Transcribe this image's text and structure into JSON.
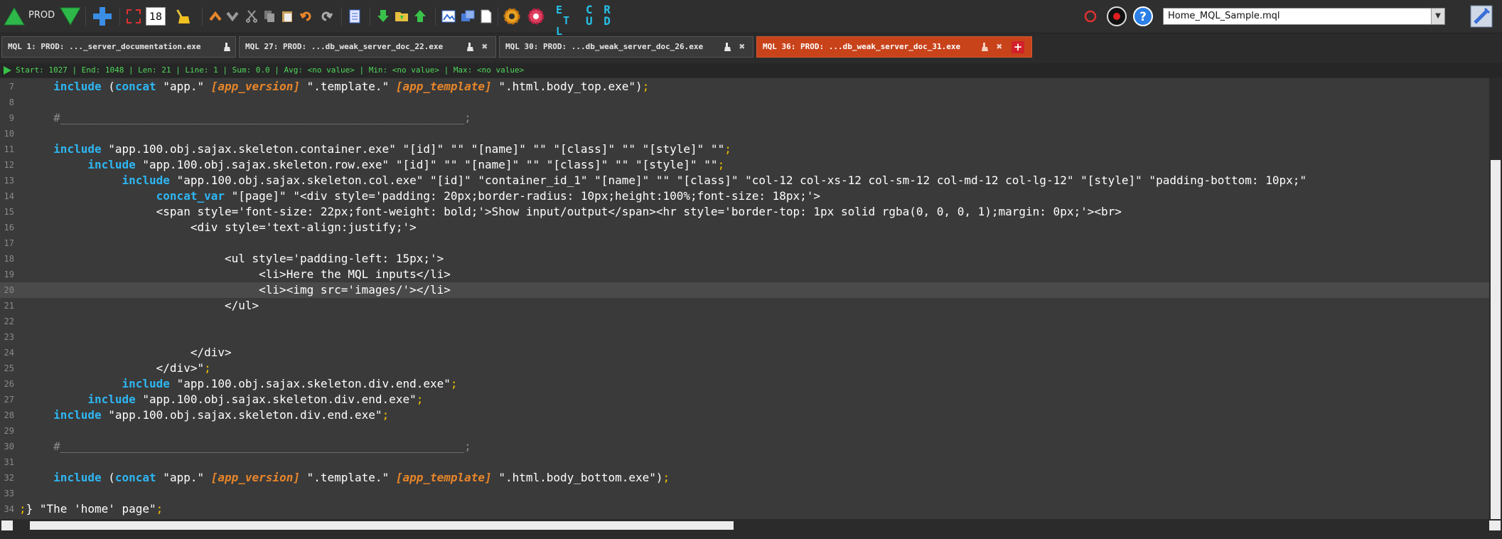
{
  "toolbar": {
    "prod_label": "PROD",
    "zoom_value": "18",
    "file_select": "Home_MQL_Sample.mql",
    "crud": [
      "C R",
      "U D"
    ],
    "etl": [
      "E",
      "T",
      "L"
    ]
  },
  "tabs": [
    {
      "label": "MQL 1: PROD: ..._server_documentation.exe",
      "active": false
    },
    {
      "label": "MQL 27: PROD: ...db_weak_server_doc_22.exe",
      "active": false
    },
    {
      "label": "MQL 30: PROD: ...db_weak_server_doc_26.exe",
      "active": false
    },
    {
      "label": "MQL 36: PROD: ...db_weak_server_doc_31.exe",
      "active": true
    }
  ],
  "status": {
    "text": "Start: 1027 | End: 1048 | Len: 21 | Line: 1 | Sum: 0.0 | Avg: <no value> | Min: <no value> | Max: <no value>"
  },
  "colors": {
    "keyword": "#2eb6f2",
    "variable": "#e8862a",
    "punctuation": "#f2c200",
    "active_tab": "#c8421a",
    "status": "#4fd85a"
  },
  "code": {
    "lines": [
      {
        "n": "7",
        "indent": "    ",
        "parts": [
          [
            "kw",
            "include"
          ],
          [
            "str",
            " ("
          ],
          [
            "fn",
            "concat"
          ],
          [
            "str",
            " \"app.\" "
          ],
          [
            "var",
            "[app_version]"
          ],
          [
            "str",
            " \".template.\" "
          ],
          [
            "var",
            "[app_template]"
          ],
          [
            "str",
            " \".html.body_top.exe\")"
          ],
          [
            "punc",
            ";"
          ]
        ]
      },
      {
        "n": "8",
        "indent": "",
        "parts": []
      },
      {
        "n": "9",
        "indent": "    ",
        "parts": [
          [
            "cmt",
            "#___________________________________________________________;"
          ]
        ]
      },
      {
        "n": "10",
        "indent": "",
        "parts": []
      },
      {
        "n": "11",
        "indent": "    ",
        "parts": [
          [
            "kw",
            "include"
          ],
          [
            "str",
            " \"app.100.obj.sajax.skeleton.container.exe\" \"[id]\" \"\" \"[name]\" \"\" \"[class]\" \"\" \"[style]\" \"\""
          ],
          [
            "punc",
            ";"
          ]
        ]
      },
      {
        "n": "12",
        "indent": "         ",
        "parts": [
          [
            "kw",
            "include"
          ],
          [
            "str",
            " \"app.100.obj.sajax.skeleton.row.exe\" \"[id]\" \"\" \"[name]\" \"\" \"[class]\" \"\" \"[style]\" \"\""
          ],
          [
            "punc",
            ";"
          ]
        ]
      },
      {
        "n": "13",
        "indent": "              ",
        "parts": [
          [
            "kw",
            "include"
          ],
          [
            "str",
            " \"app.100.obj.sajax.skeleton.col.exe\" \"[id]\" \"container_id_1\" \"[name]\" \"\" \"[class]\" \"col-12 col-xs-12 col-sm-12 col-md-12 col-lg-12\" \"[style]\" \"padding-bottom: 10px;\""
          ]
        ]
      },
      {
        "n": "14",
        "indent": "                   ",
        "parts": [
          [
            "kw",
            "concat_var"
          ],
          [
            "str",
            " \"[page]\" \"<div style='padding: 20px;border-radius: 10px;height:100%;font-size: 18px;'>"
          ]
        ]
      },
      {
        "n": "15",
        "indent": "                   ",
        "parts": [
          [
            "str",
            "<span style='font-size: 22px;font-weight: bold;'>Show input/output</span><hr style='border-top: 1px solid rgba(0, 0, 0, 1);margin: 0px;'><br>"
          ]
        ]
      },
      {
        "n": "16",
        "indent": "                        ",
        "parts": [
          [
            "str",
            "<div style='text-align:justify;'>"
          ]
        ]
      },
      {
        "n": "17",
        "indent": "",
        "parts": []
      },
      {
        "n": "18",
        "indent": "                             ",
        "parts": [
          [
            "str",
            "<ul style='padding-left: 15px;'>"
          ]
        ]
      },
      {
        "n": "19",
        "indent": "                                  ",
        "parts": [
          [
            "str",
            "<li>Here the MQL inputs</li>"
          ]
        ]
      },
      {
        "n": "20",
        "indent": "                                  ",
        "parts": [
          [
            "str",
            "<li><img src='images/'></li>"
          ]
        ],
        "highlight": true
      },
      {
        "n": "21",
        "indent": "                             ",
        "parts": [
          [
            "str",
            "</ul>"
          ]
        ]
      },
      {
        "n": "22",
        "indent": "",
        "parts": []
      },
      {
        "n": "23",
        "indent": "",
        "parts": []
      },
      {
        "n": "24",
        "indent": "                        ",
        "parts": [
          [
            "str",
            "</div>"
          ]
        ]
      },
      {
        "n": "25",
        "indent": "                   ",
        "parts": [
          [
            "str",
            "</div>\""
          ],
          [
            "punc",
            ";"
          ]
        ]
      },
      {
        "n": "26",
        "indent": "              ",
        "parts": [
          [
            "kw",
            "include"
          ],
          [
            "str",
            " \"app.100.obj.sajax.skeleton.div.end.exe\""
          ],
          [
            "punc",
            ";"
          ]
        ]
      },
      {
        "n": "27",
        "indent": "         ",
        "parts": [
          [
            "kw",
            "include"
          ],
          [
            "str",
            " \"app.100.obj.sajax.skeleton.div.end.exe\""
          ],
          [
            "punc",
            ";"
          ]
        ]
      },
      {
        "n": "28",
        "indent": "    ",
        "parts": [
          [
            "kw",
            "include"
          ],
          [
            "str",
            " \"app.100.obj.sajax.skeleton.div.end.exe\""
          ],
          [
            "punc",
            ";"
          ]
        ]
      },
      {
        "n": "29",
        "indent": "",
        "parts": []
      },
      {
        "n": "30",
        "indent": "    ",
        "parts": [
          [
            "cmt",
            "#___________________________________________________________;"
          ]
        ]
      },
      {
        "n": "31",
        "indent": "",
        "parts": []
      },
      {
        "n": "32",
        "indent": "    ",
        "parts": [
          [
            "kw",
            "include"
          ],
          [
            "str",
            " ("
          ],
          [
            "fn",
            "concat"
          ],
          [
            "str",
            " \"app.\" "
          ],
          [
            "var",
            "[app_version]"
          ],
          [
            "str",
            " \".template.\" "
          ],
          [
            "var",
            "[app_template]"
          ],
          [
            "str",
            " \".html.body_bottom.exe\")"
          ],
          [
            "punc",
            ";"
          ]
        ]
      },
      {
        "n": "33",
        "indent": "",
        "parts": []
      },
      {
        "n": "34",
        "indent": "",
        "parts": [
          [
            "punc",
            ";"
          ],
          [
            "str",
            "} \"The 'home' page\""
          ],
          [
            "punc",
            ";"
          ]
        ]
      }
    ]
  }
}
